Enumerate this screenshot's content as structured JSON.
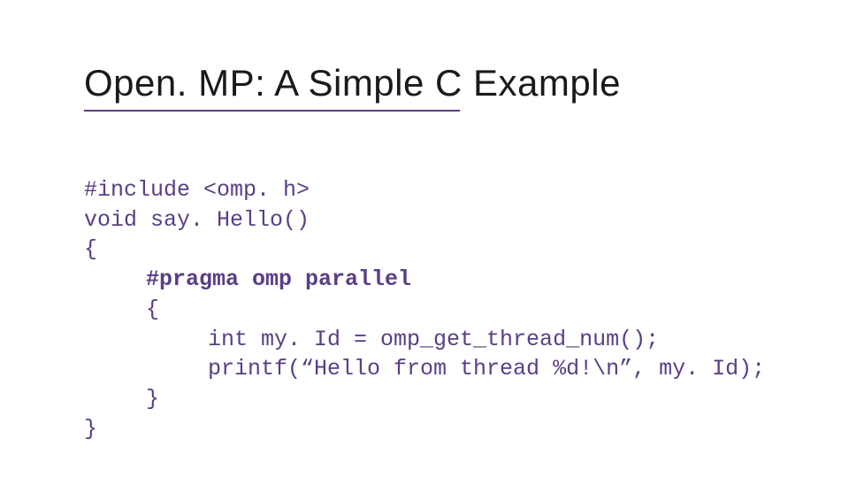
{
  "title": "Open. MP: A Simple C Example",
  "code": {
    "l1": "#include <omp. h>",
    "l2": "void say. Hello()",
    "l3": "{",
    "l4": "#pragma omp parallel",
    "l5": "{",
    "l6": "int my. Id = omp_get_thread_num();",
    "l7": "printf(“Hello from thread %d!\\n”, my. Id);",
    "l8": "}",
    "l9": "}"
  }
}
